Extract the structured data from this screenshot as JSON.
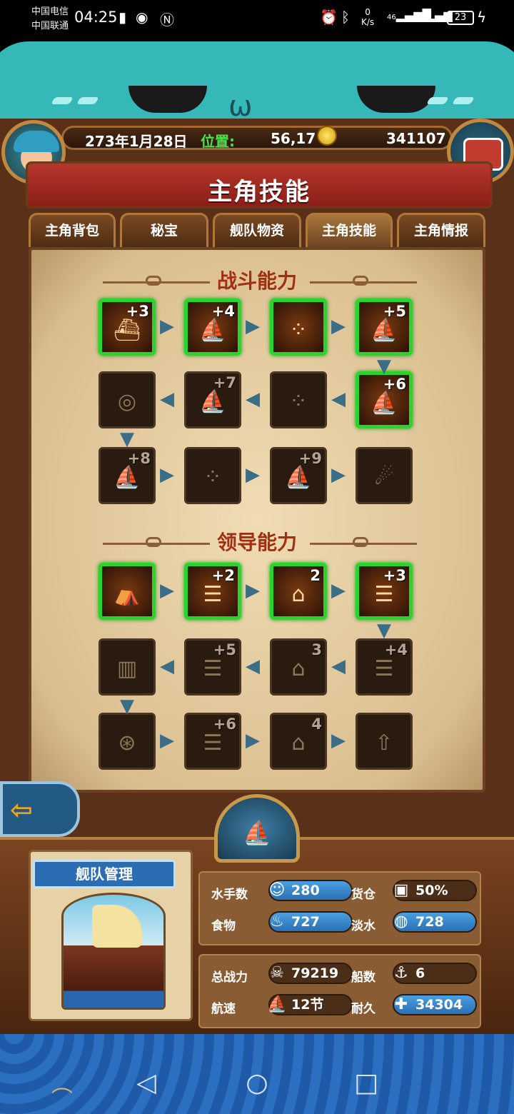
{
  "status_bar": {
    "carrier1": "中国电信",
    "carrier2": "中国联通",
    "time": "04:25",
    "net_speed_value": "0",
    "net_speed_unit": "K/s",
    "signal1": "46",
    "signal2": "36",
    "battery": "23"
  },
  "header": {
    "date": "273年1月28日",
    "position_label": "位置:",
    "position_value": "56,17",
    "gold": "341107"
  },
  "title": "主角技能",
  "tabs": [
    {
      "label": "主角背包",
      "active": false
    },
    {
      "label": "秘宝",
      "active": false
    },
    {
      "label": "舰队物资",
      "active": false
    },
    {
      "label": "主角技能",
      "active": true
    },
    {
      "label": "主角情报",
      "active": false
    }
  ],
  "sections": {
    "combat_title": "战斗能力",
    "leader_title": "领导能力"
  },
  "combat_skills": [
    {
      "icon": "ships-cannon-icon",
      "level": "+3",
      "state": "done"
    },
    {
      "icon": "fleet-sail-icon",
      "level": "+4",
      "state": "done"
    },
    {
      "icon": "formation-dots-icon",
      "level": "",
      "state": "done"
    },
    {
      "icon": "sails-icon",
      "level": "+5",
      "state": "done"
    },
    {
      "icon": "sails-icon",
      "level": "+6",
      "state": "done"
    },
    {
      "icon": "formation-dots-icon",
      "level": "",
      "state": "locked"
    },
    {
      "icon": "sails-icon",
      "level": "+7",
      "state": "locked"
    },
    {
      "icon": "cannons-icon",
      "level": "",
      "state": "locked"
    },
    {
      "icon": "sails-icon",
      "level": "+8",
      "state": "locked"
    },
    {
      "icon": "formation-dots-icon",
      "level": "",
      "state": "locked"
    },
    {
      "icon": "sails-icon",
      "level": "+9",
      "state": "locked"
    },
    {
      "icon": "cannonball-icon",
      "level": "",
      "state": "locked"
    }
  ],
  "leader_skills": [
    {
      "icon": "market-tent-icon",
      "level": "",
      "state": "done"
    },
    {
      "icon": "dock-icon",
      "level": "+2",
      "state": "done"
    },
    {
      "icon": "house-upgrade-icon",
      "level": "2",
      "state": "done"
    },
    {
      "icon": "dock-icon",
      "level": "+3",
      "state": "done"
    },
    {
      "icon": "dock-icon",
      "level": "+4",
      "state": "locked"
    },
    {
      "icon": "house-upgrade-icon",
      "level": "3",
      "state": "locked"
    },
    {
      "icon": "dock-icon",
      "level": "+5",
      "state": "locked"
    },
    {
      "icon": "fence-icon",
      "level": "",
      "state": "locked"
    },
    {
      "icon": "wheel-icon",
      "level": "",
      "state": "locked"
    },
    {
      "icon": "dock-icon",
      "level": "+6",
      "state": "locked"
    },
    {
      "icon": "house-upgrade-icon",
      "level": "4",
      "state": "locked"
    },
    {
      "icon": "coin-upgrade-icon",
      "level": "",
      "state": "locked"
    }
  ],
  "fleet": {
    "title": "舰队管理",
    "sailors_label": "水手数",
    "sailors": "280",
    "cargo_label": "货仓",
    "cargo": "50%",
    "food_label": "食物",
    "food": "727",
    "water_label": "淡水",
    "water": "728",
    "power_label": "总战力",
    "power": "79219",
    "ships_label": "船数",
    "ships": "6",
    "speed_label": "航速",
    "speed": "12节",
    "durability_label": "耐久",
    "durability": "34304"
  },
  "colors": {
    "done_border": "#29d52b",
    "title_red": "#a32e12",
    "arrow_blue": "#3b6d86"
  }
}
